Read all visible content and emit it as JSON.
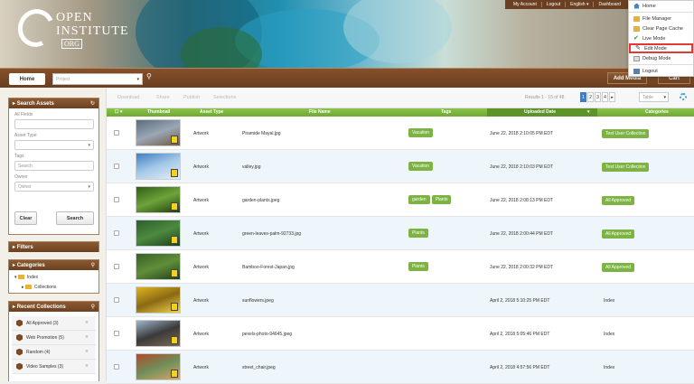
{
  "header": {
    "logo_line1": "OPEN",
    "logo_line2": "INSTITUTE",
    "logo_line3": "ORG"
  },
  "account_bar": {
    "my_account": "My Account",
    "logout": "Logout",
    "language": "English ▾",
    "dashboard": "Dashboard"
  },
  "dropdown": {
    "items": [
      {
        "label": "Home",
        "icon": "home-icon"
      },
      {
        "label": "File Manager",
        "icon": "folder-icon"
      },
      {
        "label": "Clear Page Cache",
        "icon": "folder-icon"
      },
      {
        "label": "Live Mode",
        "icon": "check-icon"
      },
      {
        "label": "Edit Mode",
        "icon": "pencil-icon"
      },
      {
        "label": "Debug Mode",
        "icon": "debug-icon"
      },
      {
        "label": "Logout",
        "icon": "logout-icon"
      }
    ]
  },
  "nav": {
    "home": "Home",
    "project_placeholder": "Project",
    "add_media": "Add Media",
    "cart": "Cart"
  },
  "sidebar": {
    "search_assets": "Search Assets",
    "all_fields": "All Fields",
    "asset_type": "Asset Type",
    "tags": "Tags",
    "search_placeholder": "Search",
    "owner": "Owner",
    "owner_placeholder": "Owner",
    "clear": "Clear",
    "search": "Search",
    "filters": "Filters",
    "categories": "Categories",
    "tree_index": "Index",
    "tree_collections": "Collections",
    "recent_collections": "Recent Collections",
    "collections": [
      "All Approved (3)",
      "Web Promotion (5)",
      "Random (4)",
      "Video Samples (3)"
    ]
  },
  "toolbar": {
    "download": "Download",
    "share": "Share",
    "publish": "Publish",
    "selections": "Selections",
    "results": "Results 1 - 15 of 48",
    "pages": [
      "1",
      "2",
      "3",
      "4",
      "▸"
    ],
    "view": "Table"
  },
  "table": {
    "headers": {
      "thumbnail": "Thumbnail",
      "asset_type": "Asset Type",
      "file_name": "File Name",
      "tags": "Tags",
      "uploaded_date": "Uploaded Date",
      "categories": "Categories"
    },
    "rows": [
      {
        "type": "Artwork",
        "file": "Piramide Mayal.jpg",
        "tags": [
          "Vacation"
        ],
        "date": "June 22, 2018 2:10:05 PM EDT",
        "category": "Test User Collection",
        "cat_tag": true,
        "thumb": [
          "#5a6c7c",
          "#9aa7b5",
          "#6f5a43"
        ]
      },
      {
        "type": "Artwork",
        "file": "valley.jpg",
        "tags": [
          "Vacation"
        ],
        "date": "June 22, 2018 2:10:03 PM EDT",
        "category": "Test User Collection",
        "cat_tag": true,
        "thumb": [
          "#3f7fc2",
          "#a6c9e8",
          "#e6edf2"
        ]
      },
      {
        "type": "Artwork",
        "file": "garden-plants.jpeg",
        "tags": [
          "garden",
          "Plants"
        ],
        "date": "June 22, 2018 2:08:13 PM EDT",
        "category": "All Approved",
        "cat_tag": true,
        "thumb": [
          "#2f5e16",
          "#6ea33a",
          "#203d0e"
        ]
      },
      {
        "type": "Artwork",
        "file": "green-leaves-palm-92733.jpg",
        "tags": [
          "Plants"
        ],
        "date": "June 22, 2018 2:00:44 PM EDT",
        "category": "All Approved",
        "cat_tag": true,
        "thumb": [
          "#2c5f2b",
          "#4d8a3f",
          "#1d3e1c"
        ]
      },
      {
        "type": "Artwork",
        "file": "Bamboo-Forest-Japan.jpg",
        "tags": [
          "Plants"
        ],
        "date": "June 22, 2018 2:00:32 PM EDT",
        "category": "All Approved",
        "cat_tag": true,
        "thumb": [
          "#385f23",
          "#5f8f3a",
          "#24401a"
        ]
      },
      {
        "type": "Artwork",
        "file": "sunflowers.jpeg",
        "tags": [],
        "date": "April 2, 2018 5:10:25 PM EDT",
        "category": "Index",
        "cat_tag": false,
        "thumb": [
          "#e0b51e",
          "#8a6a14",
          "#f1d34a"
        ]
      },
      {
        "type": "Artwork",
        "file": "pexels-photo-94645.jpeg",
        "tags": [],
        "date": "April 2, 2018 5:05:46 PM EDT",
        "category": "Index",
        "cat_tag": false,
        "thumb": [
          "#9fb7cc",
          "#3a3a3a",
          "#7e6a55"
        ]
      },
      {
        "type": "Artwork",
        "file": "street_chair.jpeg",
        "tags": [],
        "date": "April 2, 2018 4:57:56 PM EDT",
        "category": "Index",
        "cat_tag": false,
        "thumb": [
          "#b04a2a",
          "#6f8f5a",
          "#d9a46a"
        ]
      }
    ]
  }
}
